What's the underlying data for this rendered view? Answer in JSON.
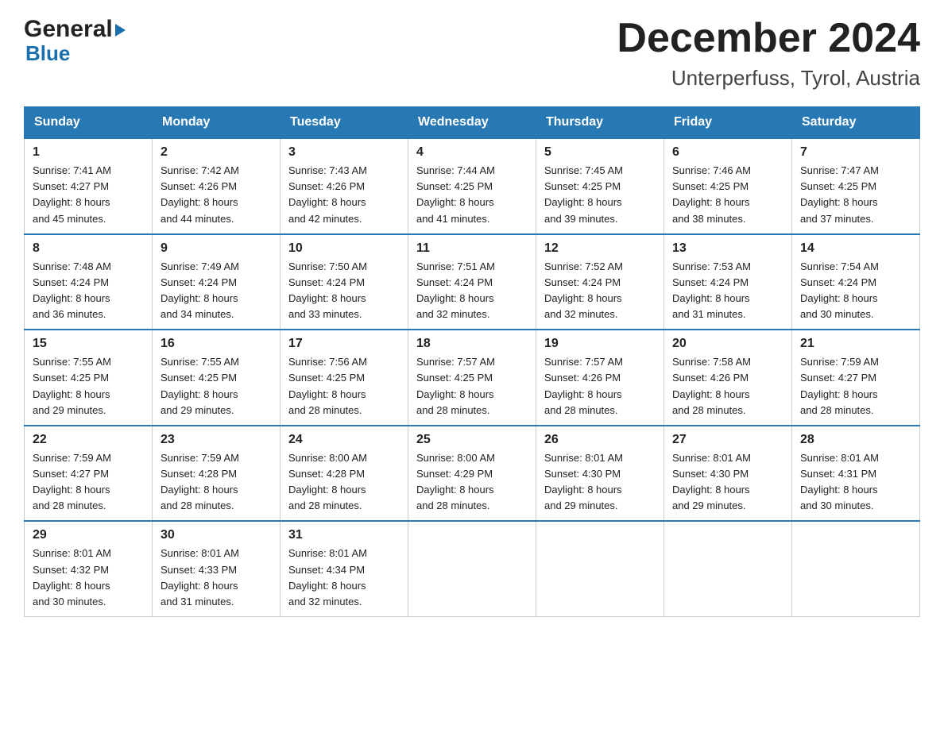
{
  "header": {
    "logo_general": "General",
    "logo_blue": "Blue",
    "month_title": "December 2024",
    "location": "Unterperfuss, Tyrol, Austria"
  },
  "days_of_week": [
    "Sunday",
    "Monday",
    "Tuesday",
    "Wednesday",
    "Thursday",
    "Friday",
    "Saturday"
  ],
  "weeks": [
    [
      {
        "day": "1",
        "sunrise": "7:41 AM",
        "sunset": "4:27 PM",
        "daylight": "8 hours and 45 minutes."
      },
      {
        "day": "2",
        "sunrise": "7:42 AM",
        "sunset": "4:26 PM",
        "daylight": "8 hours and 44 minutes."
      },
      {
        "day": "3",
        "sunrise": "7:43 AM",
        "sunset": "4:26 PM",
        "daylight": "8 hours and 42 minutes."
      },
      {
        "day": "4",
        "sunrise": "7:44 AM",
        "sunset": "4:25 PM",
        "daylight": "8 hours and 41 minutes."
      },
      {
        "day": "5",
        "sunrise": "7:45 AM",
        "sunset": "4:25 PM",
        "daylight": "8 hours and 39 minutes."
      },
      {
        "day": "6",
        "sunrise": "7:46 AM",
        "sunset": "4:25 PM",
        "daylight": "8 hours and 38 minutes."
      },
      {
        "day": "7",
        "sunrise": "7:47 AM",
        "sunset": "4:25 PM",
        "daylight": "8 hours and 37 minutes."
      }
    ],
    [
      {
        "day": "8",
        "sunrise": "7:48 AM",
        "sunset": "4:24 PM",
        "daylight": "8 hours and 36 minutes."
      },
      {
        "day": "9",
        "sunrise": "7:49 AM",
        "sunset": "4:24 PM",
        "daylight": "8 hours and 34 minutes."
      },
      {
        "day": "10",
        "sunrise": "7:50 AM",
        "sunset": "4:24 PM",
        "daylight": "8 hours and 33 minutes."
      },
      {
        "day": "11",
        "sunrise": "7:51 AM",
        "sunset": "4:24 PM",
        "daylight": "8 hours and 32 minutes."
      },
      {
        "day": "12",
        "sunrise": "7:52 AM",
        "sunset": "4:24 PM",
        "daylight": "8 hours and 32 minutes."
      },
      {
        "day": "13",
        "sunrise": "7:53 AM",
        "sunset": "4:24 PM",
        "daylight": "8 hours and 31 minutes."
      },
      {
        "day": "14",
        "sunrise": "7:54 AM",
        "sunset": "4:24 PM",
        "daylight": "8 hours and 30 minutes."
      }
    ],
    [
      {
        "day": "15",
        "sunrise": "7:55 AM",
        "sunset": "4:25 PM",
        "daylight": "8 hours and 29 minutes."
      },
      {
        "day": "16",
        "sunrise": "7:55 AM",
        "sunset": "4:25 PM",
        "daylight": "8 hours and 29 minutes."
      },
      {
        "day": "17",
        "sunrise": "7:56 AM",
        "sunset": "4:25 PM",
        "daylight": "8 hours and 28 minutes."
      },
      {
        "day": "18",
        "sunrise": "7:57 AM",
        "sunset": "4:25 PM",
        "daylight": "8 hours and 28 minutes."
      },
      {
        "day": "19",
        "sunrise": "7:57 AM",
        "sunset": "4:26 PM",
        "daylight": "8 hours and 28 minutes."
      },
      {
        "day": "20",
        "sunrise": "7:58 AM",
        "sunset": "4:26 PM",
        "daylight": "8 hours and 28 minutes."
      },
      {
        "day": "21",
        "sunrise": "7:59 AM",
        "sunset": "4:27 PM",
        "daylight": "8 hours and 28 minutes."
      }
    ],
    [
      {
        "day": "22",
        "sunrise": "7:59 AM",
        "sunset": "4:27 PM",
        "daylight": "8 hours and 28 minutes."
      },
      {
        "day": "23",
        "sunrise": "7:59 AM",
        "sunset": "4:28 PM",
        "daylight": "8 hours and 28 minutes."
      },
      {
        "day": "24",
        "sunrise": "8:00 AM",
        "sunset": "4:28 PM",
        "daylight": "8 hours and 28 minutes."
      },
      {
        "day": "25",
        "sunrise": "8:00 AM",
        "sunset": "4:29 PM",
        "daylight": "8 hours and 28 minutes."
      },
      {
        "day": "26",
        "sunrise": "8:01 AM",
        "sunset": "4:30 PM",
        "daylight": "8 hours and 29 minutes."
      },
      {
        "day": "27",
        "sunrise": "8:01 AM",
        "sunset": "4:30 PM",
        "daylight": "8 hours and 29 minutes."
      },
      {
        "day": "28",
        "sunrise": "8:01 AM",
        "sunset": "4:31 PM",
        "daylight": "8 hours and 30 minutes."
      }
    ],
    [
      {
        "day": "29",
        "sunrise": "8:01 AM",
        "sunset": "4:32 PM",
        "daylight": "8 hours and 30 minutes."
      },
      {
        "day": "30",
        "sunrise": "8:01 AM",
        "sunset": "4:33 PM",
        "daylight": "8 hours and 31 minutes."
      },
      {
        "day": "31",
        "sunrise": "8:01 AM",
        "sunset": "4:34 PM",
        "daylight": "8 hours and 32 minutes."
      },
      null,
      null,
      null,
      null
    ]
  ],
  "labels": {
    "sunrise": "Sunrise:",
    "sunset": "Sunset:",
    "daylight": "Daylight:"
  }
}
